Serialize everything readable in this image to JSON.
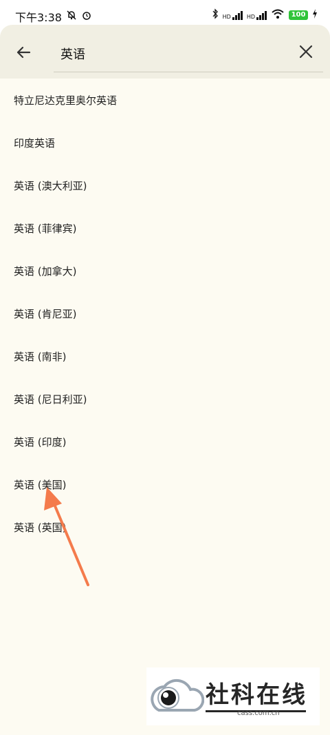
{
  "status": {
    "time": "下午3:38",
    "battery": "100",
    "signal_hd1": "HD",
    "signal_hd2": "HD"
  },
  "search": {
    "query": "英语"
  },
  "languages": [
    "特立尼达克里奥尔英语",
    "印度英语",
    "英语 (澳大利亚)",
    "英语 (菲律宾)",
    "英语 (加拿大)",
    "英语 (肯尼亚)",
    "英语 (南非)",
    "英语 (尼日利亚)",
    "英语 (印度)",
    "英语 (美国)",
    "英语 (英国)"
  ],
  "watermark": {
    "title": "社科在线",
    "domain": "cass.com.cn"
  },
  "colors": {
    "header": "#f1efe3",
    "background": "#fdfbf2",
    "arrow": "#f47b4c",
    "battery": "#31c43a"
  }
}
